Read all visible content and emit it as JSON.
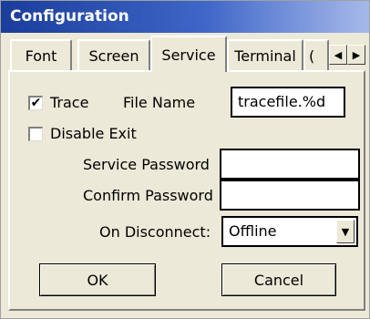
{
  "window": {
    "title": "Configuration"
  },
  "tabs": [
    {
      "label": "Font"
    },
    {
      "label": "Screen"
    },
    {
      "label": "Service"
    },
    {
      "label": "Terminal"
    },
    {
      "label": "("
    }
  ],
  "service": {
    "trace": {
      "label": "Trace",
      "checked": true
    },
    "file_name": {
      "label": "File Name",
      "value": "tracefile.%d"
    },
    "disable_exit": {
      "label": "Disable Exit",
      "checked": false
    },
    "service_password": {
      "label": "Service Password",
      "value": ""
    },
    "confirm_password": {
      "label": "Confirm Password",
      "value": ""
    },
    "on_disconnect": {
      "label": "On Disconnect:",
      "value": "Offline"
    }
  },
  "buttons": {
    "ok": "OK",
    "cancel": "Cancel"
  },
  "icons": {
    "check": "✔",
    "scroll_left": "◀",
    "scroll_right": "▶",
    "dropdown": "▼"
  }
}
